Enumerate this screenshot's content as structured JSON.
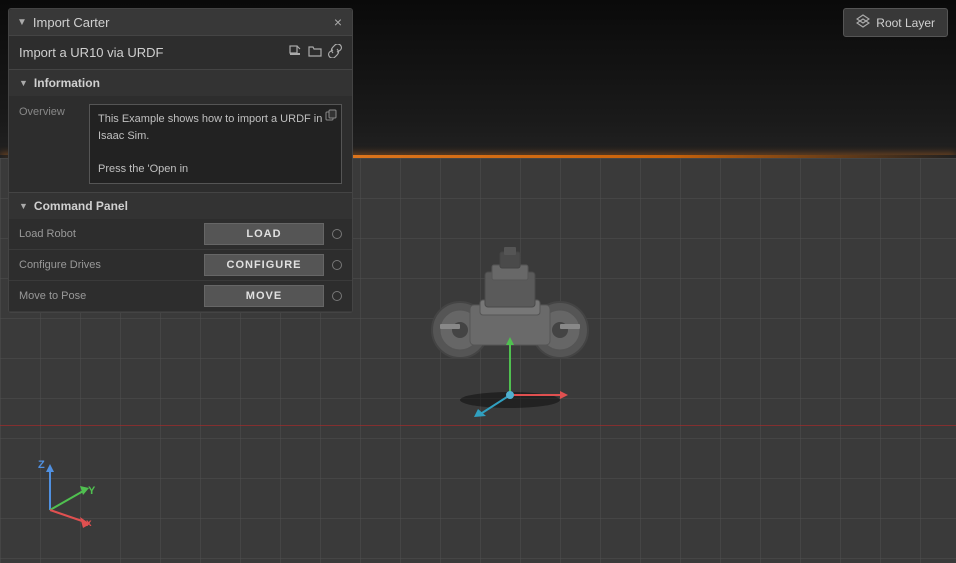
{
  "viewport": {
    "background": "#2a2a2a"
  },
  "root_layer_button": {
    "label": "Root Layer",
    "icon": "layers-icon"
  },
  "panel": {
    "title": "Import Carter",
    "header_title": "Import a UR10 via URDF",
    "icons": [
      "edit-icon",
      "folder-icon",
      "link-icon"
    ],
    "close_label": "×",
    "information_section": {
      "title": "Information",
      "overview_label": "Overview",
      "overview_text": "This Example shows how to import a URDF in Isaac Sim.\n\nPress the 'Open in"
    },
    "command_panel": {
      "title": "Command Panel",
      "rows": [
        {
          "label": "Load Robot",
          "button": "LOAD"
        },
        {
          "label": "Configure Drives",
          "button": "CONFIGURE"
        },
        {
          "label": "Move to Pose",
          "button": "MOVE"
        }
      ]
    }
  },
  "coord": {
    "z_label": "Z",
    "y_label": "Y",
    "x_label": "x"
  }
}
